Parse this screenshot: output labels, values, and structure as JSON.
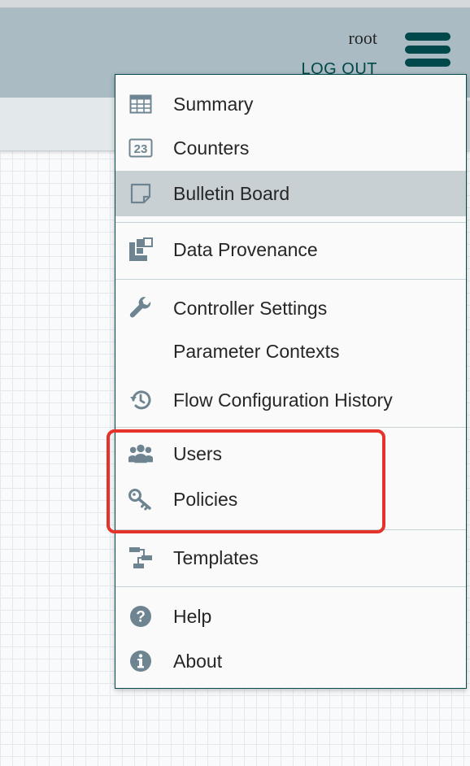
{
  "header": {
    "user": "root",
    "logout_label": "LOG OUT"
  },
  "menu": {
    "items": [
      {
        "label": "Summary",
        "icon": "table-icon"
      },
      {
        "label": "Counters",
        "icon": "counter-23-icon"
      },
      {
        "label": "Bulletin Board",
        "icon": "sticky-note-icon",
        "active": true
      },
      {
        "label": "Data Provenance",
        "icon": "provenance-icon"
      },
      {
        "label": "Controller Settings",
        "icon": "wrench-icon"
      },
      {
        "label": "Parameter Contexts",
        "icon": ""
      },
      {
        "label": "Flow Configuration History",
        "icon": "history-icon"
      },
      {
        "label": "Users",
        "icon": "users-icon"
      },
      {
        "label": "Policies",
        "icon": "key-icon"
      },
      {
        "label": "Templates",
        "icon": "template-icon"
      },
      {
        "label": "Help",
        "icon": "question-circle-icon"
      },
      {
        "label": "About",
        "icon": "info-circle-icon"
      }
    ]
  },
  "colors": {
    "header_bg": "#aabbc3",
    "accent": "#004849",
    "menu_icon": "#6e8591",
    "active_item_bg": "#c8d0d4",
    "highlight_border": "#e5322b"
  }
}
